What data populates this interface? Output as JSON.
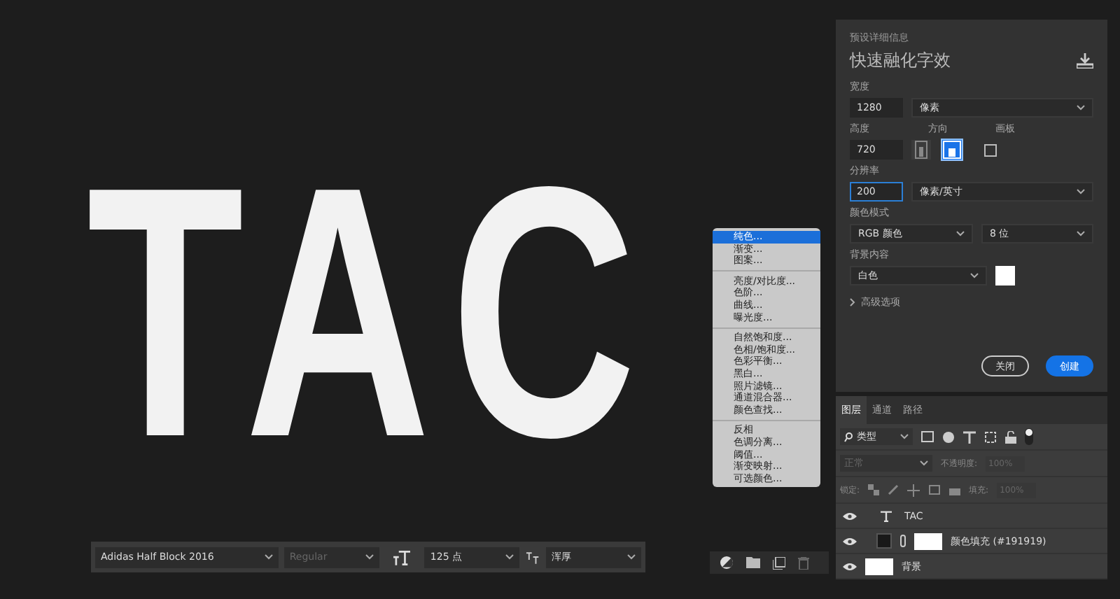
{
  "canvas": {
    "text": "TAC"
  },
  "dialog": {
    "section": "预设详细信息",
    "title": "快速融化字效",
    "width": {
      "label": "宽度",
      "value": "1280",
      "unit": "像素"
    },
    "height": {
      "label": "高度",
      "value": "720"
    },
    "orientation": {
      "label": "方向",
      "options": [
        {
          "kind": "portrait",
          "selected": false
        },
        {
          "kind": "landscape",
          "selected": true
        }
      ]
    },
    "artboard": {
      "label": "画板",
      "checked": false
    },
    "resolution": {
      "label": "分辨率",
      "value": "200",
      "unit": "像素/英寸",
      "focused": true
    },
    "color_mode": {
      "label": "颜色模式",
      "value": "RGB 颜色",
      "depth": "8 位"
    },
    "background": {
      "label": "背景内容",
      "value": "白色",
      "color": "#ffffff"
    },
    "advanced": {
      "label": "高级选项",
      "expanded": false
    },
    "buttons": [
      {
        "label": "关闭",
        "kind": "secondary"
      },
      {
        "label": "创建",
        "kind": "primary"
      }
    ]
  },
  "adjust_menu": {
    "groups": [
      [
        {
          "label": "纯色...",
          "selected": true
        },
        {
          "label": "渐变...",
          "selected": false
        },
        {
          "label": "图案...",
          "selected": false
        }
      ],
      [
        {
          "label": "亮度/对比度...",
          "selected": false
        },
        {
          "label": "色阶...",
          "selected": false
        },
        {
          "label": "曲线...",
          "selected": false
        },
        {
          "label": "曝光度...",
          "selected": false
        }
      ],
      [
        {
          "label": "自然饱和度...",
          "selected": false
        },
        {
          "label": "色相/饱和度...",
          "selected": false
        },
        {
          "label": "色彩平衡...",
          "selected": false
        },
        {
          "label": "黑白...",
          "selected": false
        },
        {
          "label": "照片滤镜...",
          "selected": false
        },
        {
          "label": "通道混合器...",
          "selected": false
        },
        {
          "label": "颜色查找...",
          "selected": false
        }
      ],
      [
        {
          "label": "反相",
          "selected": false
        },
        {
          "label": "色调分离...",
          "selected": false
        },
        {
          "label": "阈值...",
          "selected": false
        },
        {
          "label": "渐变映射...",
          "selected": false
        },
        {
          "label": "可选颜色...",
          "selected": false
        }
      ]
    ]
  },
  "layers_panel": {
    "tabs": [
      {
        "label": "图层",
        "selected": true
      },
      {
        "label": "通道",
        "selected": false
      },
      {
        "label": "路径",
        "selected": false
      }
    ],
    "filter": "类型",
    "blend_mode": {
      "value": "正常",
      "disabled": true
    },
    "opacity": {
      "label": "不透明度:",
      "value": "100%",
      "disabled": true
    },
    "lock": {
      "label": "锁定:"
    },
    "fill": {
      "label": "填充:",
      "value": "100%",
      "disabled": true
    },
    "layers": [
      {
        "kind": "text",
        "name": "TAC",
        "visible": true
      },
      {
        "kind": "fill",
        "name": "颜色填充 (#191919)",
        "visible": true,
        "color": "#191919"
      },
      {
        "kind": "background",
        "name": "背景",
        "visible": true
      }
    ]
  },
  "type_bar": {
    "font": "Adidas Half Block 2016",
    "style": {
      "value": "Regular",
      "disabled": true
    },
    "size": "125 点",
    "antialias": "浑厚"
  }
}
